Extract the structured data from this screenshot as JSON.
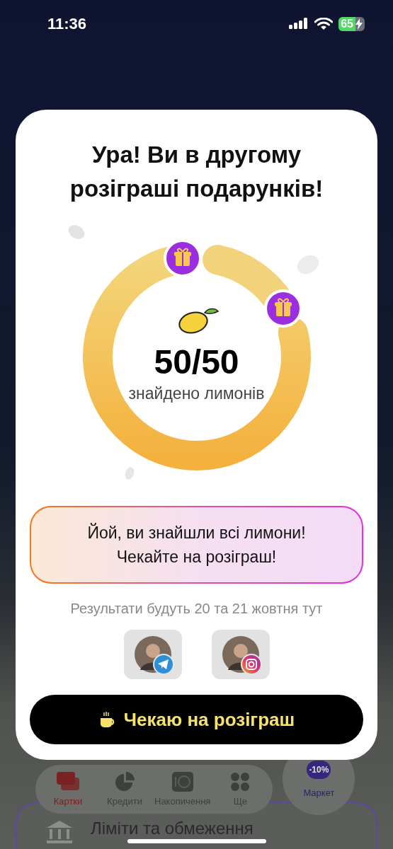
{
  "status_bar": {
    "time": "11:36",
    "battery": "65"
  },
  "modal": {
    "title": "Ура! Ви в другому розіграші подарунків!",
    "progress": {
      "count": "50/50",
      "caption": "знайдено лимонів"
    },
    "message": [
      "Йой, ви знайшли всі лимони!",
      "Чекайте на розіграш!"
    ],
    "results_note": "Результати будуть 20 та 21 жовтня тут",
    "socials": [
      {
        "kind": "telegram"
      },
      {
        "kind": "instagram"
      }
    ],
    "button": "Чекаю на розіграш"
  },
  "tab_bar": {
    "items": [
      {
        "label": "Картки",
        "kind": "cards",
        "selected": true
      },
      {
        "label": "Кредити",
        "kind": "pie",
        "selected": false
      },
      {
        "label": "Накопичення",
        "kind": "savings",
        "selected": false
      },
      {
        "label": "Ще",
        "kind": "more",
        "selected": false
      }
    ],
    "market": {
      "label": "Маркет",
      "badge": "-10%"
    }
  },
  "background_card": {
    "title": "Ліміти та обмеження"
  }
}
